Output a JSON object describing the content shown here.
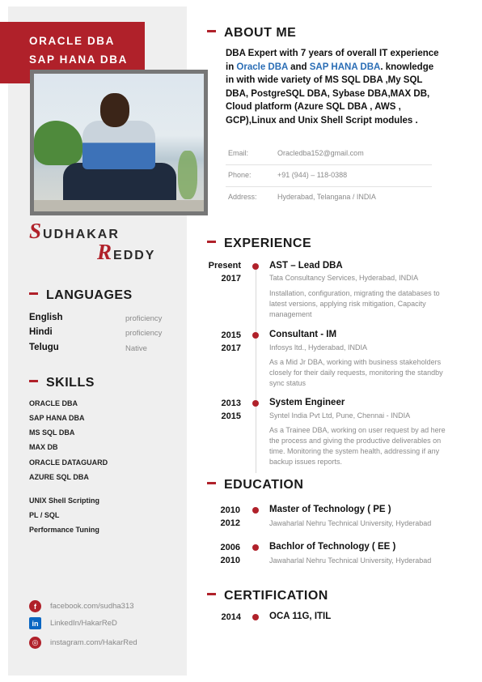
{
  "header": {
    "role_line1": "ORACLE DBA",
    "role_line2": "SAP HANA DBA"
  },
  "name": {
    "first_initial": "S",
    "first_rest": "UDHAKAR",
    "last_initial": "R",
    "last_rest": "EDDY"
  },
  "about": {
    "heading": "ABOUT ME",
    "text_1": "DBA Expert with 7 years of overall IT experience in ",
    "hl_1": "Oracle DBA",
    "text_2": " and ",
    "hl_2": "SAP HANA DBA",
    "text_3": ". knowledge in with wide variety of MS SQL DBA ,My SQL DBA, PostgreSQL DBA, Sybase DBA,MAX DB, Cloud platform (Azure SQL DBA , AWS , GCP),Linux and Unix Shell Script modules ."
  },
  "contact": [
    {
      "label": "Email:",
      "value": "Oracledba152@gmail.com"
    },
    {
      "label": "Phone:",
      "value": "+91 (944) – 118-0388"
    },
    {
      "label": "Address:",
      "value": "Hyderabad, Telangana / INDIA"
    }
  ],
  "languages": {
    "heading": "LANGUAGES",
    "items": [
      {
        "name": "English",
        "level": "proficiency"
      },
      {
        "name": "Hindi",
        "level": "proficiency"
      },
      {
        "name": "Telugu",
        "level": "Native"
      }
    ]
  },
  "skills": {
    "heading": "SKILLS",
    "items": [
      "ORACLE DBA",
      "SAP HANA DBA",
      "MS SQL DBA",
      "MAX DB",
      "ORACLE DATAGUARD",
      "AZURE SQL DBA",
      "UNIX Shell Scripting",
      "PL / SQL",
      "Performance Tuning"
    ]
  },
  "social": [
    {
      "icon": "facebook-icon",
      "glyph": "f",
      "text": "facebook.com/sudha313"
    },
    {
      "icon": "linkedin-icon",
      "glyph": "in",
      "text": "LinkedIn/HakarReD"
    },
    {
      "icon": "instagram-icon",
      "glyph": "◎",
      "text": "instagram.com/HakarRed"
    }
  ],
  "experience": {
    "heading": "EXPERIENCE",
    "items": [
      {
        "from": "Present",
        "to": "2017",
        "title": "AST – Lead DBA",
        "company": "Tata Consultancy Services, Hyderabad, INDIA",
        "desc": "Installation, configuration, migrating the databases to latest versions, applying risk mitigation, Capacity management"
      },
      {
        "from": "2015",
        "to": "2017",
        "title": "Consultant - IM",
        "company": "Infosys ltd., Hyderabad, INDIA",
        "desc": "As a Mid Jr DBA, working with business stakeholders closely for their daily requests, monitoring the standby sync status"
      },
      {
        "from": "2013",
        "to": "2015",
        "title": "System Engineer",
        "company": "Syntel India Pvt Ltd, Pune, Chennai - INDIA",
        "desc": "As a Trainee DBA, working on user request by ad here the process and giving the productive deliverables on time. Monitoring the system health, addressing if any backup issues reports."
      }
    ]
  },
  "education": {
    "heading": "EDUCATION",
    "items": [
      {
        "from": "2010",
        "to": "2012",
        "title": "Master of Technology ( PE )",
        "school": "Jawaharlal Nehru Technical University, Hyderabad"
      },
      {
        "from": "2006",
        "to": "2010",
        "title": "Bachlor of Technology ( EE )",
        "school": "Jawaharlal Nehru Technical University, Hyderabad"
      }
    ]
  },
  "certification": {
    "heading": "CERTIFICATION",
    "year": "2014",
    "title": "OCA 11G, ITIL"
  },
  "colors": {
    "accent": "#b0212a",
    "link": "#2a6db5",
    "sidebar": "#efefef"
  }
}
